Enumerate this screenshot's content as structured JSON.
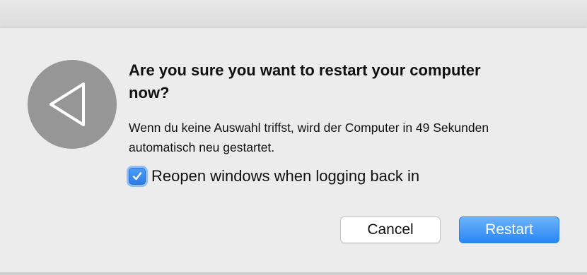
{
  "dialog": {
    "title": "Are you sure you want to restart your computer now?",
    "message": "Wenn du keine Auswahl triffst, wird der Computer in 49 Sekunden automatisch neu gestartet.",
    "icon": "restart-triangle-icon",
    "checkbox": {
      "label": "Reopen windows when logging back in",
      "checked": true
    },
    "buttons": {
      "cancel": "Cancel",
      "restart": "Restart"
    }
  },
  "colors": {
    "accent": "#2a86f4",
    "icon_circle": "#969696",
    "dialog_background": "#ececec"
  }
}
